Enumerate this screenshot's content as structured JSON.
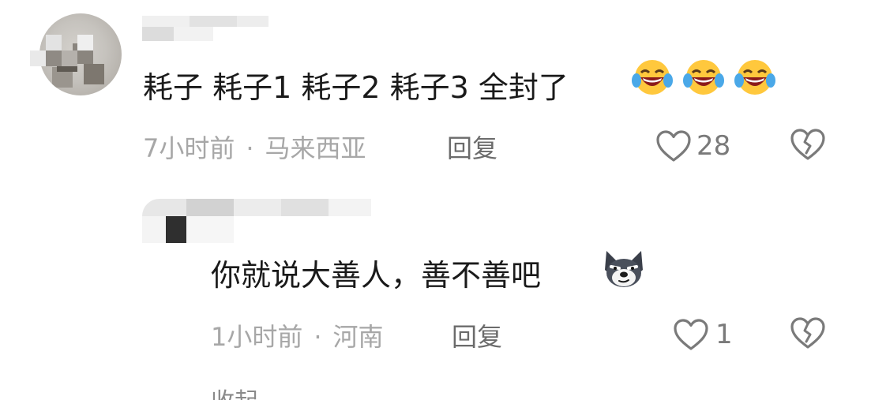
{
  "comments": [
    {
      "author": "",
      "text": "耗子 耗子1 耗子2 耗子3 全封了",
      "emojis": [
        "laughing-crying-emoji",
        "laughing-crying-emoji",
        "laughing-crying-emoji"
      ],
      "time": "7小时前",
      "separator": "·",
      "location": "马来西亚",
      "reply_label": "回复",
      "likes": "28"
    },
    {
      "author": "",
      "text": "你就说大善人，善不善吧",
      "emojis": [
        "wolf-smirk-emoji"
      ],
      "time": "1小时前",
      "separator": "·",
      "location": "河南",
      "reply_label": "回复",
      "likes": "1"
    }
  ],
  "collapse_label": "收起",
  "colors": {
    "text_primary": "#1a1a1a",
    "text_meta": "#a7a7a7",
    "reply": "#6b6b6b",
    "icon": "#7a7a7a"
  },
  "icons": [
    "heart-outline-icon",
    "broken-heart-icon",
    "chevron-up-icon"
  ]
}
